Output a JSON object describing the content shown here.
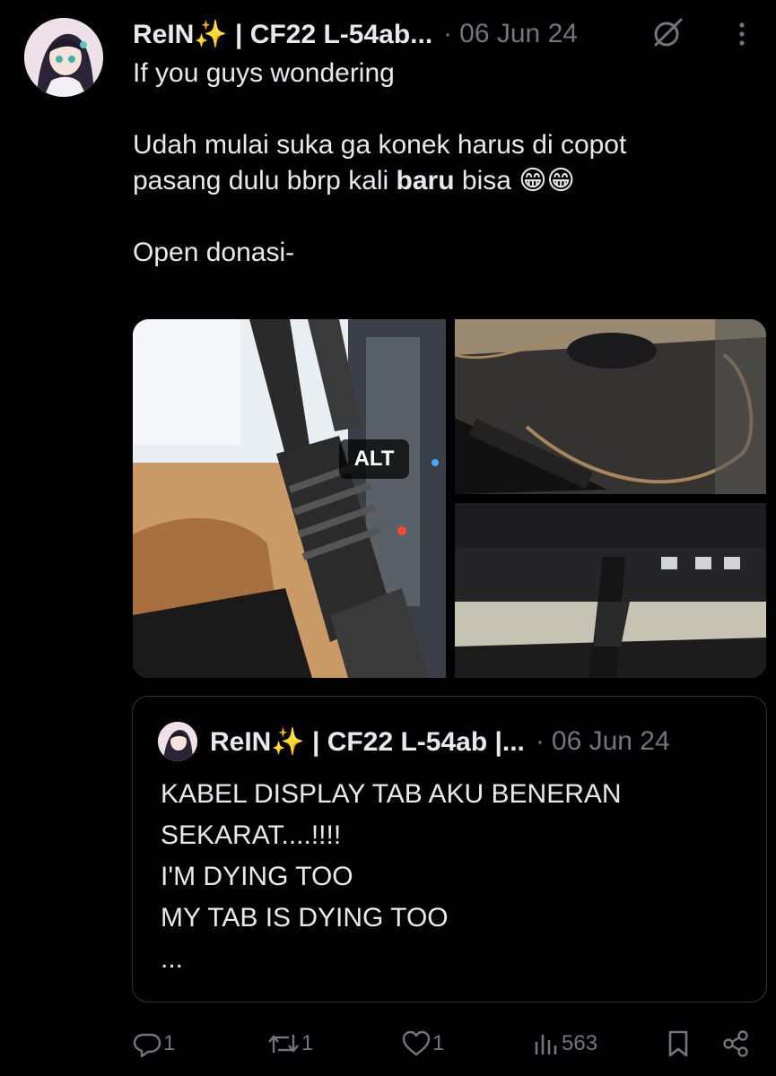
{
  "tweet": {
    "author": "ReIN✨ | CF22 L-54ab...",
    "separator": "·",
    "date": "06 Jun 24",
    "text": {
      "line1": "If you guys wondering",
      "line2a": "Udah mulai suka ga konek harus di copot",
      "line2b_start": "pasang dulu bbrp kali ",
      "line2b_bold": "baru",
      "line2b_end": " bisa 😁😁",
      "line3": "Open donasi-"
    },
    "media": {
      "alt_label": "ALT"
    }
  },
  "quote": {
    "author": "ReIN✨ | CF22 L-54ab |...",
    "separator": "·",
    "date": "06 Jun 24",
    "lines": [
      "KABEL DISPLAY TAB AKU BENERAN",
      "SEKARAT....!!!!",
      "I'M DYING TOO",
      "MY TAB IS DYING TOO",
      "..."
    ]
  },
  "actions": {
    "replies": "1",
    "reposts": "1",
    "likes": "1",
    "views": "563"
  },
  "colors": {
    "background": "#000000",
    "text": "#e7e9ea",
    "muted": "#71767b",
    "border": "#2f3336"
  },
  "icons": [
    "more-icon",
    "grok-icon",
    "reply-icon",
    "repost-icon",
    "like-icon",
    "views-icon",
    "bookmark-icon",
    "share-icon"
  ]
}
